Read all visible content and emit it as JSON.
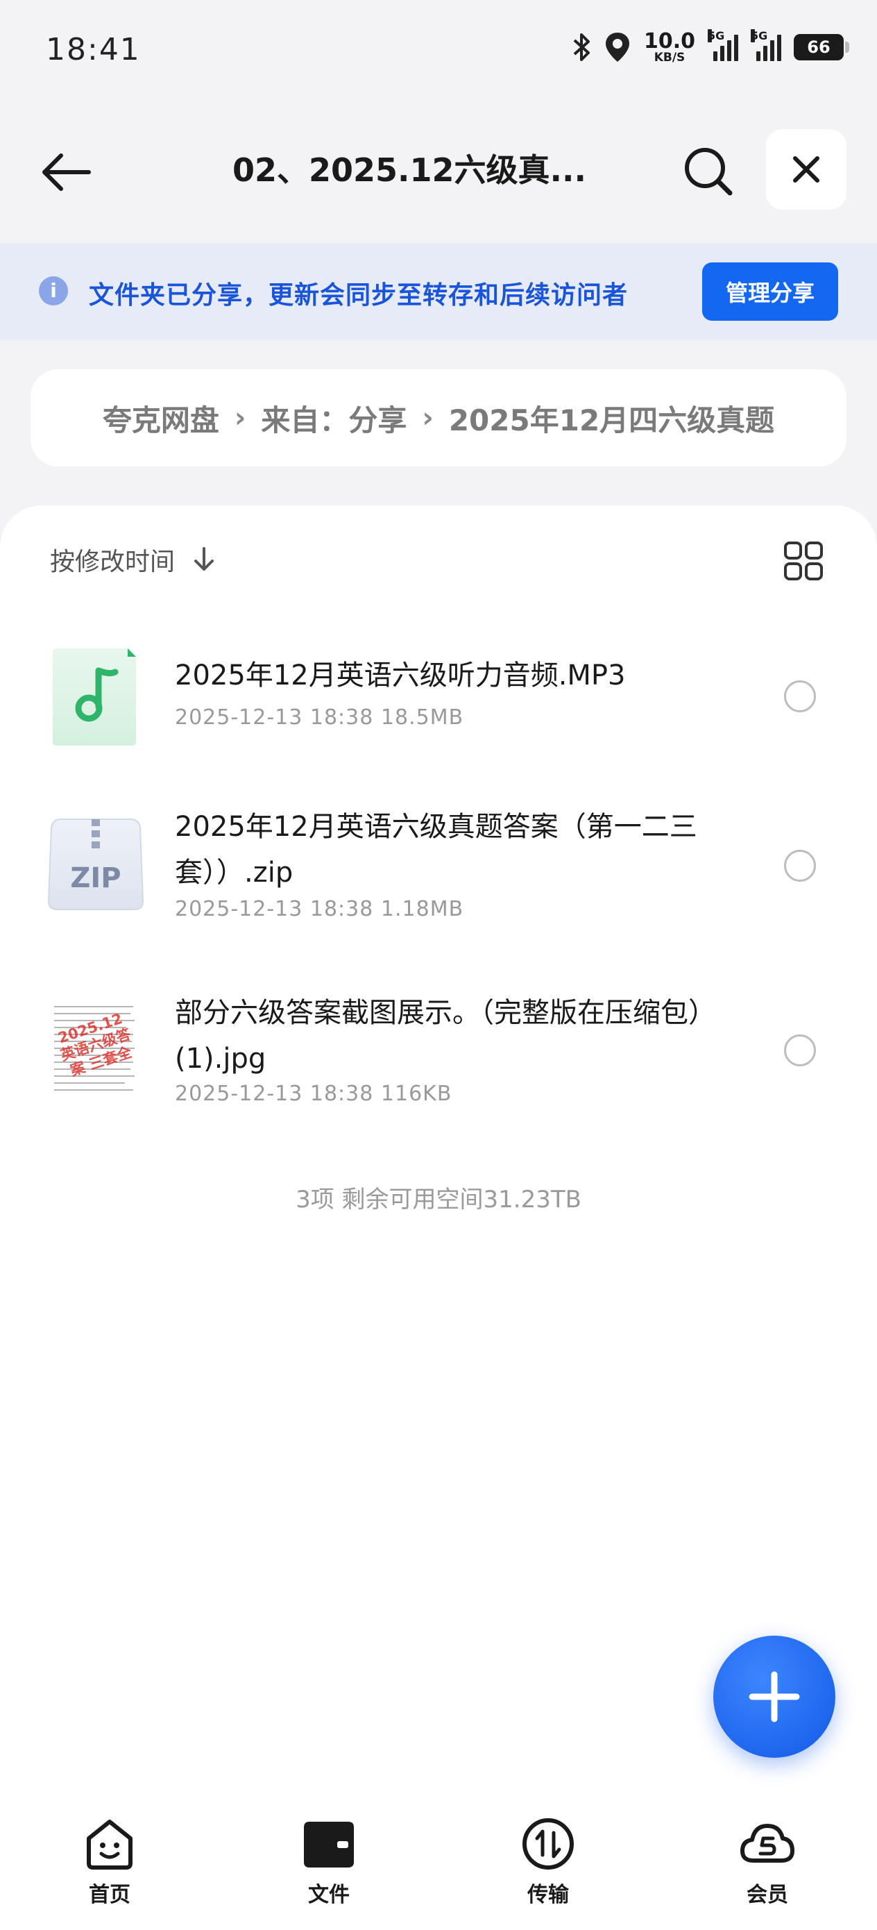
{
  "status_bar": {
    "time": "18:41",
    "net_speed_value": "10.0",
    "net_speed_unit": "KB/S",
    "signal1_tag": "5G",
    "signal2_tag": "5G",
    "battery": "66"
  },
  "header": {
    "title": "02、2025.12六级真..."
  },
  "share_banner": {
    "text": "文件夹已分享，更新会同步至转存和后续访问者",
    "button": "管理分享"
  },
  "breadcrumb": [
    "夸克网盘",
    "来自：分享",
    "2025年12月四六级真题"
  ],
  "sort": {
    "label": "按修改时间"
  },
  "files": [
    {
      "name": "2025年12月英语六级听力音频.MP3",
      "date": "2025-12-13 18:38",
      "size": "18.5MB",
      "type": "audio"
    },
    {
      "name": "2025年12月英语六级真题答案（第一二三套））.zip",
      "date": "2025-12-13 18:38",
      "size": "1.18MB",
      "type": "zip",
      "icon_text": "ZIP"
    },
    {
      "name": "部分六级答案截图展示。（完整版在压缩包）(1).jpg",
      "date": "2025-12-13 18:38",
      "size": "116KB",
      "type": "image",
      "stamp_text": "2025.12 英语六级答案 三套全"
    }
  ],
  "summary": "3项 剩余可用空间31.23TB",
  "bottom_nav": [
    {
      "label": "首页",
      "icon": "home-face-icon"
    },
    {
      "label": "文件",
      "icon": "folder-icon"
    },
    {
      "label": "传输",
      "icon": "transfer-icon"
    },
    {
      "label": "会员",
      "icon": "member-cloud-icon"
    }
  ],
  "colors": {
    "accent": "#1467f0",
    "banner_bg": "#e6ebf7",
    "page_bg": "#f3f3f5"
  }
}
